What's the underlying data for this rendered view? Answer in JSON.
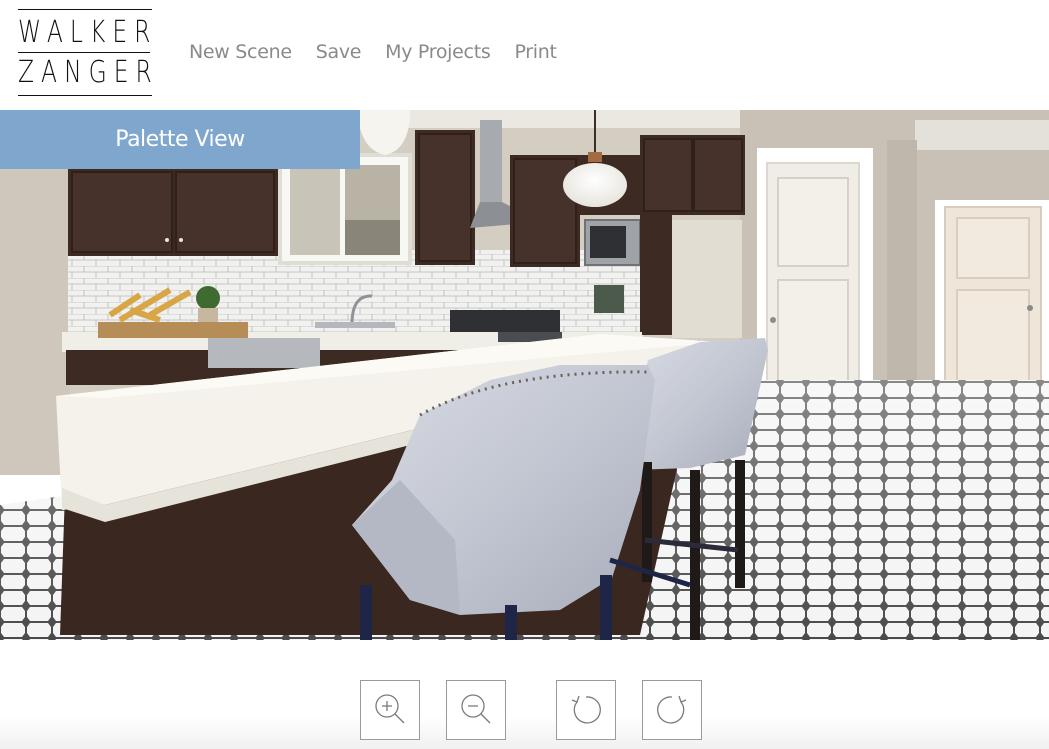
{
  "brand": {
    "line1": "WALKER",
    "line2": "ZANGER"
  },
  "nav": [
    {
      "id": "new-scene",
      "label": "New Scene"
    },
    {
      "id": "save",
      "label": "Save"
    },
    {
      "id": "my-projects",
      "label": "My Projects"
    },
    {
      "id": "print",
      "label": "Print"
    }
  ],
  "palette_view": {
    "label": "Palette View"
  },
  "controls": {
    "zoom_in": "zoom-in-icon",
    "zoom_out": "zoom-out-icon",
    "rotate_left": "rotate-left-icon",
    "rotate_right": "rotate-right-icon"
  },
  "colors": {
    "palette_tab": "#7fa6cc",
    "cabinets": "#3d2a22",
    "countertop": "#f3f1ea",
    "walls": "#d6cfc4",
    "nav_text": "#8a8a8a"
  }
}
